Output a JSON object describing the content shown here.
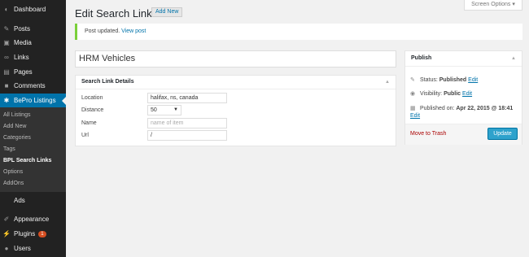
{
  "menu": {
    "items": [
      {
        "label": "Dashboard",
        "icon": "dashboard-icon"
      },
      {
        "label": "Posts",
        "icon": "pin-icon"
      },
      {
        "label": "Media",
        "icon": "media-icon"
      },
      {
        "label": "Links",
        "icon": "link-icon"
      },
      {
        "label": "Pages",
        "icon": "page-icon"
      },
      {
        "label": "Comments",
        "icon": "comment-icon"
      },
      {
        "label": "BePro Listings",
        "icon": "gear-icon"
      },
      {
        "label": "Ads",
        "icon": ""
      },
      {
        "label": "Appearance",
        "icon": "brush-icon"
      },
      {
        "label": "Plugins",
        "icon": "plug-icon",
        "badge": "1"
      },
      {
        "label": "Users",
        "icon": "user-icon"
      }
    ],
    "submenu": [
      "All Listings",
      "Add New",
      "Categories",
      "Tags",
      "BPL Search Links",
      "Options",
      "AddOns"
    ],
    "submenu_current": "BPL Search Links"
  },
  "screen_options": "Screen Options",
  "page": {
    "title": "Edit Search Link",
    "add_new": "Add New"
  },
  "notice": {
    "text": "Post updated.",
    "link": "View post",
    "accent": "#7ad03a"
  },
  "post_title": "HRM Vehicles",
  "details": {
    "title": "Search Link Details",
    "fields": [
      {
        "label": "Location",
        "value": "halifax, ns, canada"
      },
      {
        "label": "Distance",
        "value": "50"
      },
      {
        "label": "Name",
        "placeholder": "name of item"
      },
      {
        "label": "Url",
        "value": "/"
      }
    ]
  },
  "publish": {
    "title": "Publish",
    "status_label": "Status:",
    "status_value": "Published",
    "status_edit": "Edit",
    "visibility_label": "Visibility:",
    "visibility_value": "Public",
    "visibility_edit": "Edit",
    "published_label": "Published on:",
    "published_value": "Apr 22, 2015 @ 18:41",
    "published_edit": "Edit",
    "trash": "Move to Trash",
    "update": "Update"
  },
  "colors": {
    "accent": "#0073aa",
    "sidebar": "#222222",
    "button": "#2ea2cc"
  }
}
